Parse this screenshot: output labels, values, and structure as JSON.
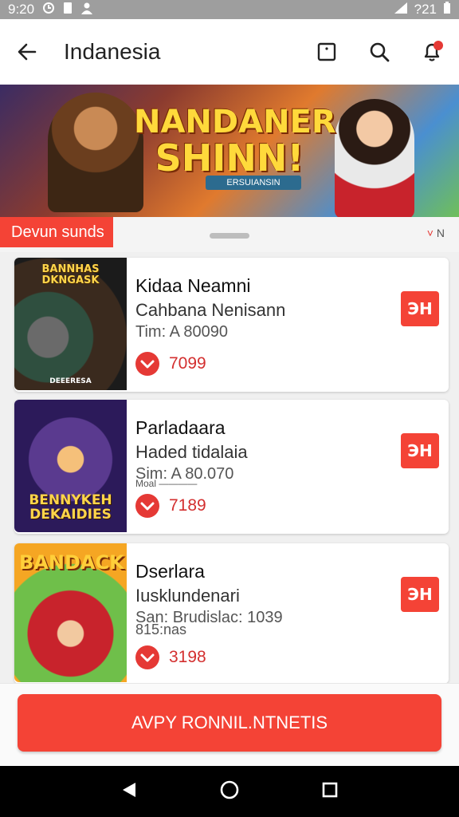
{
  "status_bar": {
    "time": "9:20",
    "battery": "?21"
  },
  "app_bar": {
    "title": "Indanesia",
    "back_icon": "arrow-back-icon",
    "actions": [
      "square-icon",
      "search-icon",
      "notification-bell-icon"
    ]
  },
  "banner": {
    "logo_line1": "NANDANER",
    "logo_line2": "SHINN!",
    "ribbon": "ERSUIANSIN"
  },
  "section": {
    "tag": "Devun sunds",
    "extra_mark": "˅",
    "extra_text": "N"
  },
  "cards": [
    {
      "thumb_title": "BANNHAS DKNGASK",
      "thumb_footer": "DEEERESA",
      "name": "Kidaa Neamni",
      "sub": "Cahbana Nenisann",
      "meta": "Tim: A 80090",
      "meta2": "",
      "price": "7099",
      "action": "ЭН"
    },
    {
      "thumb_title": "BENNYKEH DEKAIDIES",
      "thumb_footer": "",
      "name": "Parladaara",
      "sub": "Haded tidalaia",
      "meta": "Sim: A 80.070",
      "meta2": "Moal ————",
      "price": "7189",
      "action": "ЭН"
    },
    {
      "thumb_title": "BANDACK",
      "thumb_footer": "",
      "name": "Dserlara",
      "sub": "Iusklundenari",
      "meta": "San: Brudislac: 1039",
      "meta2": "815:nas",
      "price": "3198",
      "action": "ЭН"
    }
  ],
  "cta": {
    "label": "AVPY RONNIL.NTNETIS"
  },
  "colors": {
    "accent": "#f44336",
    "status_bar": "#9e9e9e",
    "nav_bar": "#000000"
  }
}
